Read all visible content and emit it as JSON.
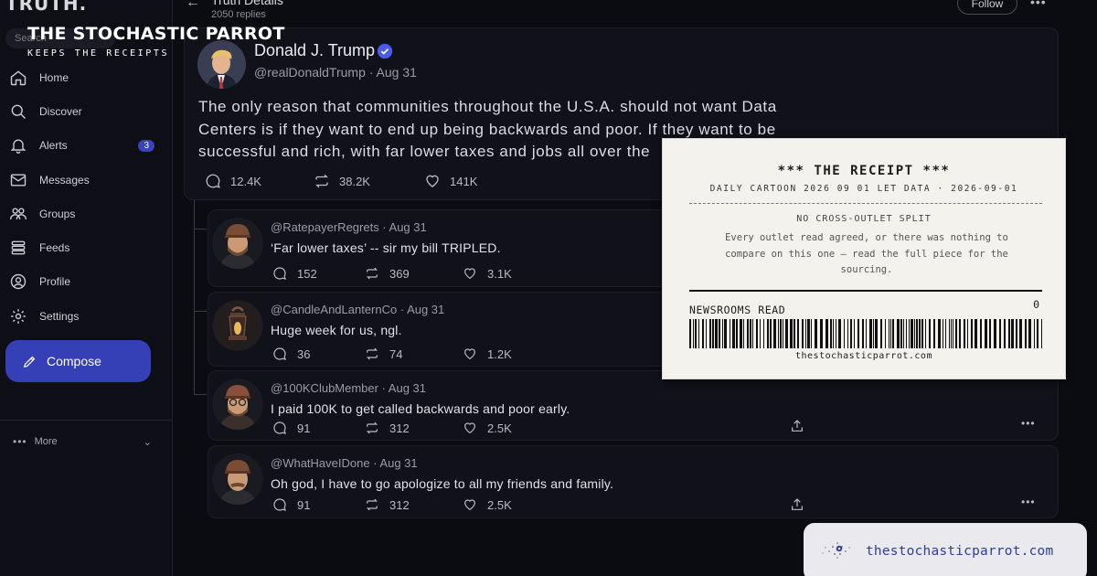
{
  "app": {
    "logo": "TRUTH.",
    "search_placeholder": "Search"
  },
  "watermark": {
    "title": "THE STOCHASTIC PARROT",
    "tagline": "KEEPS THE RECEIPTS"
  },
  "sidebar": {
    "items": [
      {
        "label": "Home",
        "icon": "home-icon"
      },
      {
        "label": "Discover",
        "icon": "search-icon"
      },
      {
        "label": "Alerts",
        "icon": "bell-icon",
        "badge": "3"
      },
      {
        "label": "Messages",
        "icon": "mail-icon"
      },
      {
        "label": "Groups",
        "icon": "groups-icon"
      },
      {
        "label": "Feeds",
        "icon": "feeds-icon"
      },
      {
        "label": "Profile",
        "icon": "profile-icon"
      },
      {
        "label": "Settings",
        "icon": "gear-icon"
      }
    ],
    "compose_label": "Compose",
    "more_label": "More"
  },
  "header": {
    "title": "Truth Details",
    "subtitle": "2050 replies",
    "follow_label": "Follow"
  },
  "main_post": {
    "author": "Donald J. Trump",
    "handle": "@realDonaldTrump",
    "date": "Aug 31",
    "meta": "@realDonaldTrump · Aug 31",
    "text": "The only reason that communities throughout the U.S.A. should not want Data Centers is if they want to end up being backwards and poor. If they want to be successful and rich, with far lower taxes and jobs all over the",
    "replies": "12.4K",
    "retruths": "38.2K",
    "likes": "141K"
  },
  "replies": [
    {
      "meta": "@RatepayerRegrets · Aug 31",
      "text": "‘Far lower taxes’ -- sir my bill TRIPLED.",
      "replies": "152",
      "retruths": "369",
      "likes": "3.1K"
    },
    {
      "meta": "@CandleAndLanternCo · Aug 31",
      "text": "Huge week for us, ngl.",
      "replies": "36",
      "retruths": "74",
      "likes": "1.2K"
    },
    {
      "meta": "@100KClubMember · Aug 31",
      "text": "I paid 100K to get called backwards and poor early.",
      "replies": "91",
      "retruths": "312",
      "likes": "2.5K"
    },
    {
      "meta": "@WhatHaveIDone · Aug 31",
      "text": "Oh god, I have to go apologize to all my friends and family.",
      "replies": "91",
      "retruths": "312",
      "likes": "2.5K"
    }
  ],
  "receipt": {
    "title": "*** THE RECEIPT ***",
    "subtitle": "DAILY CARTOON 2026 09 01 LET DATA · 2026-09-01",
    "headline": "NO CROSS-OUTLET SPLIT",
    "body": "Every outlet read agreed, or there was nothing to compare on this one — read the full piece for the sourcing.",
    "count_label": "NEWSROOMS READ",
    "count_value": "0",
    "url": "thestochasticparrot.com"
  },
  "site_badge": {
    "url": "thestochasticparrot.com"
  },
  "colors": {
    "accent": "#3540b6",
    "background": "#0b0c12",
    "card": "#101119",
    "receipt_paper": "#f4f2ec",
    "badge_link": "#2c3f9a"
  }
}
